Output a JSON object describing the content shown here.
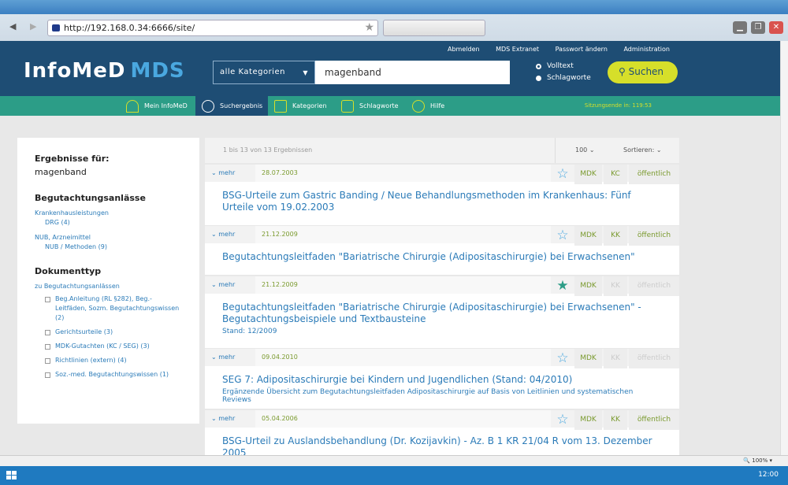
{
  "browser": {
    "url": "http://192.168.0.34:6666/site/",
    "zoom": "100%"
  },
  "header": {
    "logo_main": "InfoMeD",
    "logo_sub": "MDS",
    "top_links": [
      "Abmelden",
      "MDS Extranet",
      "Passwort ändern",
      "Administration"
    ],
    "category_select": "alle Kategorien",
    "search_value": "magenband",
    "radio_volltext": "Volltext",
    "radio_schlagworte": "Schlagworte",
    "search_button": "Suchen"
  },
  "nav": {
    "items": [
      "Mein InfoMeD",
      "Suchergebnis",
      "Kategorien",
      "Schlagworte",
      "Hilfe"
    ],
    "session": "Sitzungsende in: 119:53"
  },
  "sidebar": {
    "heading": "Ergebnisse für:",
    "query": "magenband",
    "section1": "Begutachtungsanlässe",
    "s1_link1": "Krankenhausleistungen",
    "s1_sub1": "DRG (4)",
    "s1_link2": "NUB, Arzneimittel",
    "s1_sub2": "NUB / Methoden (9)",
    "section2": "Dokumenttyp",
    "s2_link": "zu Begutachtungsanlässen",
    "checkboxes": [
      "Beg.Anleitung (RL §282), Beg.-Leitfäden, Sozm. Begutachtungswissen (2)",
      "Gerichtsurteile (3)",
      "MDK-Gutachten (KC / SEG) (3)",
      "Richtlinien (extern) (4)",
      "Soz.-med. Begutachtungswissen (1)"
    ]
  },
  "results_header": {
    "count": "1 bis 13 von 13 Ergebnissen",
    "per_page": "100",
    "sort": "Sortieren:"
  },
  "results": [
    {
      "mehr": "mehr",
      "date": "28.07.2003",
      "fav": false,
      "tags": [
        "MDK",
        "KC",
        "öffentlich"
      ],
      "tags_dim": [
        false,
        false,
        false
      ],
      "title": "BSG-Urteile zum Gastric Banding / Neue Behandlungsmethoden im Krankenhaus: Fünf Urteile vom 19.02.2003",
      "sub": ""
    },
    {
      "mehr": "mehr",
      "date": "21.12.2009",
      "fav": false,
      "tags": [
        "MDK",
        "KK",
        "öffentlich"
      ],
      "tags_dim": [
        false,
        false,
        false
      ],
      "title": "Begutachtungsleitfaden \"Bariatrische Chirurgie (Adipositaschirurgie) bei Erwachsenen\"",
      "sub": ""
    },
    {
      "mehr": "mehr",
      "date": "21.12.2009",
      "fav": true,
      "tags": [
        "MDK",
        "KK",
        "öffentlich"
      ],
      "tags_dim": [
        false,
        true,
        true
      ],
      "title": "Begutachtungsleitfaden \"Bariatrische Chirurgie (Adipositaschirurgie) bei Erwachsenen\" - Begutachtungsbeispiele und Textbausteine",
      "sub": "Stand: 12/2009"
    },
    {
      "mehr": "mehr",
      "date": "09.04.2010",
      "fav": false,
      "tags": [
        "MDK",
        "KK",
        "öffentlich"
      ],
      "tags_dim": [
        false,
        true,
        true
      ],
      "title": "SEG 7: Adipositaschirurgie bei Kindern und Jugendlichen (Stand: 04/2010)",
      "sub": "Ergänzende Übersicht zum Begutachtungsleitfaden Adipositaschirurgie auf Basis von Leitlinien und systematischen Reviews"
    },
    {
      "mehr": "mehr",
      "date": "05.04.2006",
      "fav": false,
      "tags": [
        "MDK",
        "KK",
        "öffentlich"
      ],
      "tags_dim": [
        false,
        false,
        false
      ],
      "title": "BSG-Urteil zu Auslandsbehandlung (Dr. Kozijavkin) - Az. B 1 KR 21/04 R vom 13. Dezember 2005",
      "sub": ""
    }
  ],
  "taskbar": {
    "clock": "12:00"
  }
}
